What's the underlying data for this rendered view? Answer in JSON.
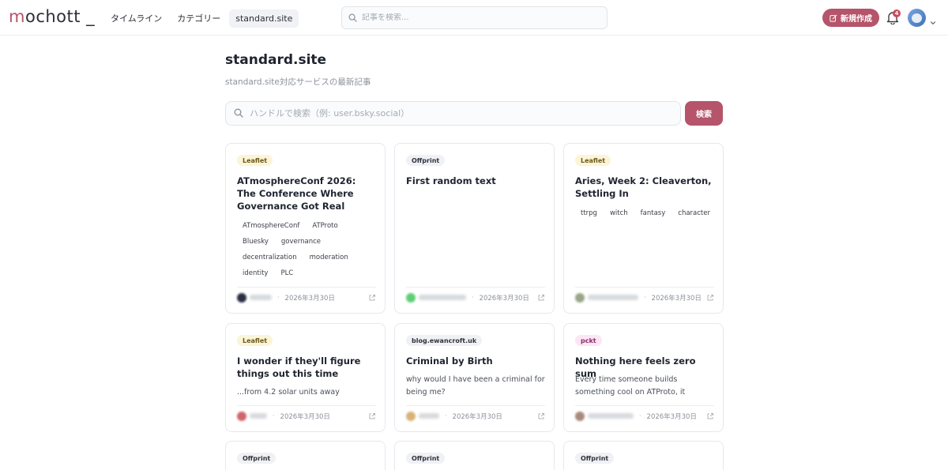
{
  "header": {
    "logo_m": "m",
    "logo_rest": "ochott _",
    "nav": [
      "タイムライン",
      "カテゴリー",
      "standard.site"
    ],
    "search_placeholder": "記事を検索...",
    "new_button": "新規作成",
    "notification_count": "4"
  },
  "page": {
    "title": "standard.site",
    "subtitle": "standard.site対応サービスの最新記事",
    "handle_search_placeholder": "ハンドルで検索（例: user.bsky.social）",
    "search_button": "検索"
  },
  "cards": [
    {
      "badge": "Leaflet",
      "title": "ATmosphereConf 2026: The Conference Where Governance Got Real",
      "tags": [
        "ATmosphereConf",
        "ATProto",
        "Bluesky",
        "governance",
        "decentralization",
        "moderation",
        "identity",
        "PLC"
      ],
      "date": "2026年3月30日"
    },
    {
      "badge": "Offprint",
      "title": "First random text",
      "date": "2026年3月30日"
    },
    {
      "badge": "Leaflet",
      "title": "Aries, Week 2: Cleaverton, Settling In",
      "tags": [
        "ttrpg",
        "witch",
        "fantasy",
        "character"
      ],
      "date": "2026年3月30日"
    },
    {
      "badge": "Leaflet",
      "title": "I wonder if they'll figure things out this time",
      "desc": "...from 4.2 solar units away",
      "date": "2026年3月30日"
    },
    {
      "badge": "blog.ewancroft.uk",
      "title": "Criminal by Birth",
      "desc": "why would I have been a criminal for being me?",
      "date": "2026年3月30日"
    },
    {
      "badge": "pckt",
      "title": "Nothing here feels zero sum",
      "desc": "Every time someone builds something cool on ATProto, it make…",
      "date": "2026年3月30日"
    },
    {
      "badge": "Offprint"
    },
    {
      "badge": "Offprint"
    },
    {
      "badge": "Offprint"
    }
  ],
  "colors": {
    "accent": "#b5546a",
    "leaflet_badge_bg": "#fbf4d6",
    "offprint_badge_bg": "#f0f1f4",
    "pckt_badge_bg": "#fbe6f3"
  },
  "icons": [
    "search-icon",
    "edit-icon",
    "bell-icon",
    "chevron-down-icon",
    "external-link-icon"
  ]
}
